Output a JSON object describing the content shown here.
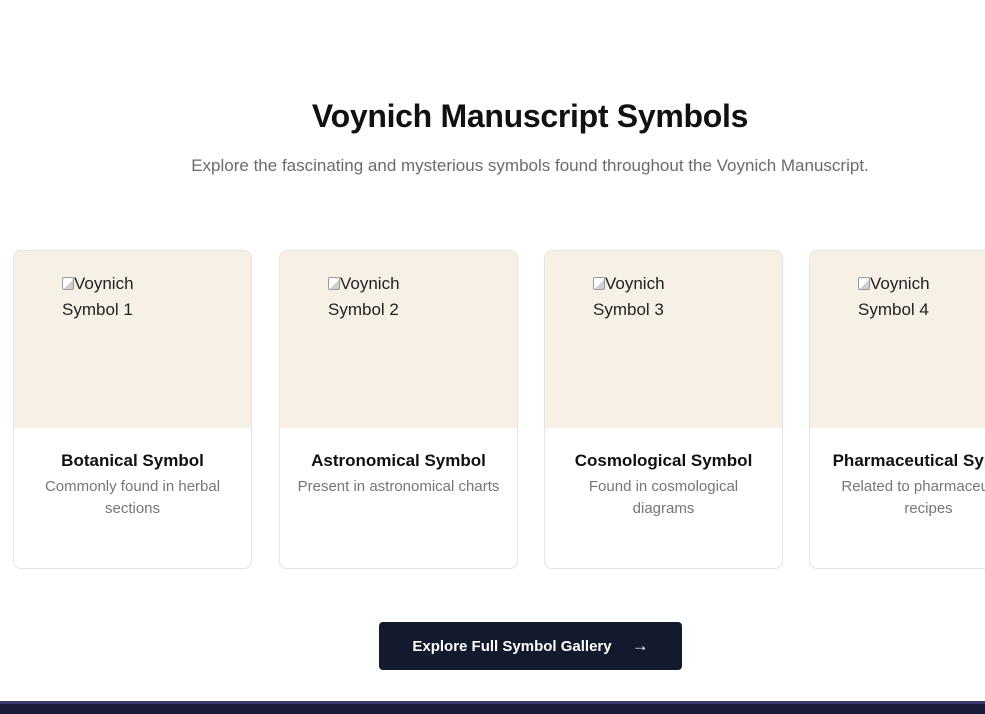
{
  "header": {
    "title": "Voynich Manuscript Symbols",
    "subtitle": "Explore the fascinating and mysterious symbols found throughout the Voynich Manuscript."
  },
  "cards": [
    {
      "alt": "Voynich Symbol 1",
      "name": "Botanical Symbol",
      "desc": "Commonly found in herbal sections"
    },
    {
      "alt": "Voynich Symbol 2",
      "name": "Astronomical Symbol",
      "desc": "Present in astronomical charts"
    },
    {
      "alt": "Voynich Symbol 3",
      "name": "Cosmological Symbol",
      "desc": "Found in cosmological diagrams"
    },
    {
      "alt": "Voynich Symbol 4",
      "name": "Pharmaceutical Symbol",
      "desc": "Related to pharmaceutical recipes"
    }
  ],
  "cta": {
    "label": "Explore Full Symbol Gallery",
    "icon": "arrow-right-icon",
    "arrow": "→"
  },
  "colors": {
    "card_media_bg": "#f7f0e6",
    "button_bg": "#141a2e",
    "footer_bg": "#1b1b3a"
  }
}
